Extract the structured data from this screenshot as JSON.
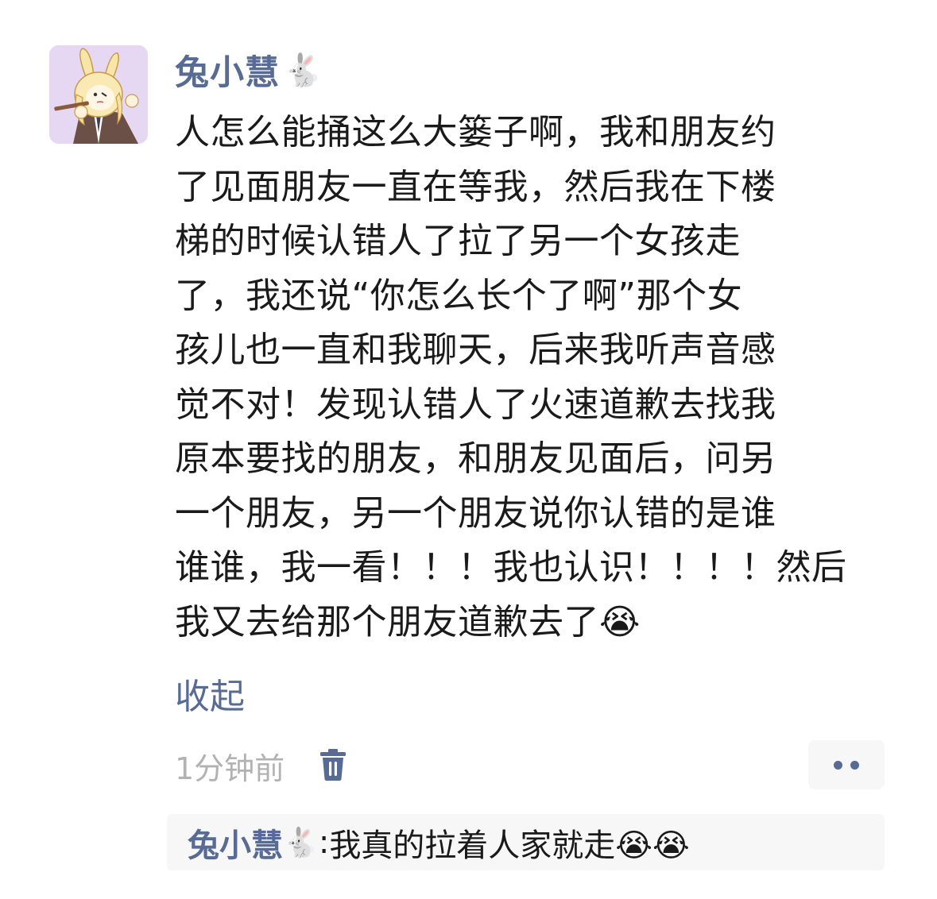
{
  "post": {
    "author": "兔小慧",
    "author_emoji": "🐇",
    "content_lines": [
      "人怎么能捅这么大篓子啊，我和朋友约",
      "了见面朋友一直在等我，然后我在下楼",
      "梯的时候认错人了拉了另一个女孩走",
      "了，我还说“你怎么长个了啊”那个女",
      "孩儿也一直和我聊天，后来我听声音感",
      "觉不对！发现认错人了火速道歉去找我",
      "原本要找的朋友，和朋友见面后，问另",
      "一个朋友，另一个朋友说你认错的是谁",
      "谁谁，我一看！！！我也认识！！！！然后",
      "我又去给那个朋友道歉去了😭"
    ],
    "collapse_label": "收起",
    "timestamp": "1分钟前"
  },
  "comment": {
    "author": "兔小慧",
    "author_emoji": "🐇",
    "separator": ": ",
    "text": "我真的拉着人家就走😭😭"
  },
  "icons": {
    "avatar": "cartoon-rabbit-avatar",
    "delete": "trash-icon",
    "more": "more-dots-icon"
  },
  "colors": {
    "link": "#576b95",
    "text": "#1a1a1a",
    "muted": "#b2b2b2",
    "panel": "#f7f7f7"
  }
}
